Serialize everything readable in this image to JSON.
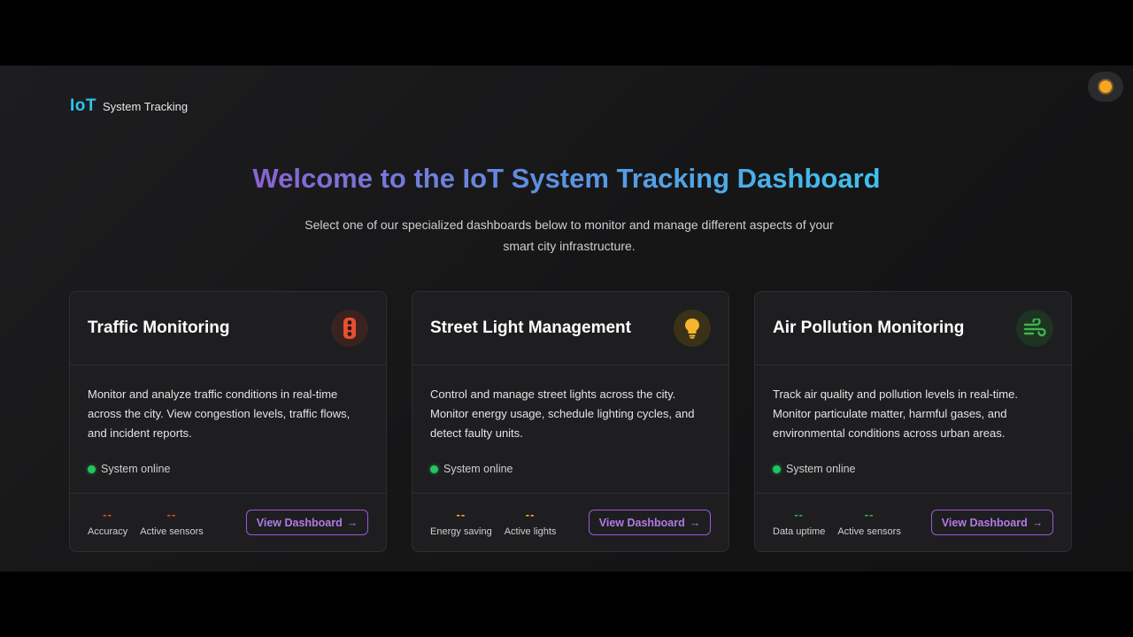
{
  "header": {
    "logo_mark": "IoT",
    "logo_text": "System Tracking",
    "theme_icon": "sun-icon"
  },
  "hero": {
    "title": "Welcome to the IoT System Tracking Dashboard",
    "subtitle": "Select one of our specialized dashboards below to monitor and manage different aspects of your smart city infrastructure."
  },
  "colors": {
    "accent": "#9b59d6",
    "status_online": "#22c55e",
    "traffic": "#e8502f",
    "streetlight": "#f5b52e",
    "air": "#3fb34f"
  },
  "cards": [
    {
      "title": "Traffic Monitoring",
      "icon": "traffic-light-icon",
      "description": "Monitor and analyze traffic conditions in real-time across the city. View congestion levels, traffic flows, and incident reports.",
      "status": "System online",
      "stats": [
        {
          "value": "--",
          "label": "Accuracy"
        },
        {
          "value": "--",
          "label": "Active sensors"
        }
      ],
      "button": "View Dashboard"
    },
    {
      "title": "Street Light Management",
      "icon": "lightbulb-icon",
      "description": "Control and manage street lights across the city. Monitor energy usage, schedule lighting cycles, and detect faulty units.",
      "status": "System online",
      "stats": [
        {
          "value": "--",
          "label": "Energy saving"
        },
        {
          "value": "--",
          "label": "Active lights"
        }
      ],
      "button": "View Dashboard"
    },
    {
      "title": "Air Pollution Monitoring",
      "icon": "wind-icon",
      "description": "Track air quality and pollution levels in real-time. Monitor particulate matter, harmful gases, and environmental conditions across urban areas.",
      "status": "System online",
      "stats": [
        {
          "value": "--",
          "label": "Data uptime"
        },
        {
          "value": "--",
          "label": "Active sensors"
        }
      ],
      "button": "View Dashboard"
    }
  ]
}
